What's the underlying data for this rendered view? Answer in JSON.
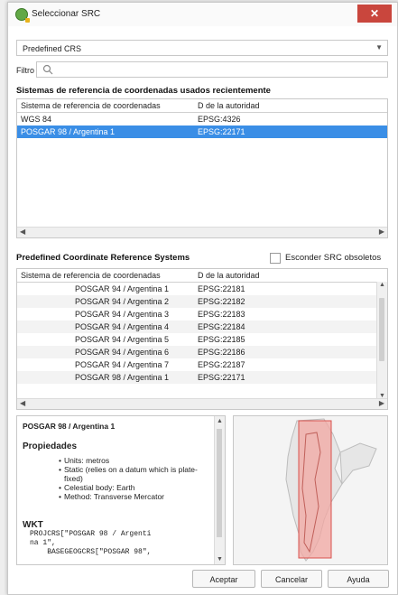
{
  "window": {
    "title": "Seleccionar SRC",
    "close_glyph": "✕"
  },
  "crs_type": {
    "selected": "Predefined CRS"
  },
  "filter": {
    "label": "Filtro",
    "value": ""
  },
  "recent": {
    "title": "Sistemas de referencia de coordenadas usados recientemente",
    "columns": [
      "Sistema de referencia de coordenadas",
      "D de la autoridad"
    ],
    "rows": [
      {
        "name": "WGS 84",
        "id": "EPSG:4326",
        "selected": false
      },
      {
        "name": "POSGAR 98 / Argentina 1",
        "id": "EPSG:22171",
        "selected": true
      }
    ]
  },
  "predefined": {
    "title": "Predefined Coordinate Reference Systems",
    "hide_deprecated_label": "Esconder SRC obsoletos",
    "hide_deprecated_checked": false,
    "columns": [
      "Sistema de referencia de coordenadas",
      "D de la autoridad"
    ],
    "rows": [
      {
        "name": "POSGAR 94 / Argentina 1",
        "id": "EPSG:22181"
      },
      {
        "name": "POSGAR 94 / Argentina 2",
        "id": "EPSG:22182"
      },
      {
        "name": "POSGAR 94 / Argentina 3",
        "id": "EPSG:22183"
      },
      {
        "name": "POSGAR 94 / Argentina 4",
        "id": "EPSG:22184"
      },
      {
        "name": "POSGAR 94 / Argentina 5",
        "id": "EPSG:22185"
      },
      {
        "name": "POSGAR 94 / Argentina 6",
        "id": "EPSG:22186"
      },
      {
        "name": "POSGAR 94 / Argentina 7",
        "id": "EPSG:22187"
      },
      {
        "name": "POSGAR 98 / Argentina 1",
        "id": "EPSG:22171"
      }
    ]
  },
  "info": {
    "crs_name": "POSGAR 98 / Argentina 1",
    "properties_title": "Propiedades",
    "properties": [
      "Units: metros",
      "Static (relies on a datum which is plate-fixed)",
      "Celestial body: Earth",
      "Method: Transverse Mercator"
    ],
    "wkt_title": "WKT",
    "wkt_lines": [
      "PROJCRS[\"POSGAR 98 / Argenti",
      "na 1\",",
      "    BASEGEOGCRS[\"POSGAR 98\","
    ]
  },
  "buttons": {
    "accept": "Aceptar",
    "cancel": "Cancelar",
    "help": "Ayuda"
  },
  "colors": {
    "selection": "#3a8ee6",
    "map_extent_fill": "#f2a7a2",
    "map_extent_stroke": "#d9534f",
    "qgis_green": "#62a846"
  }
}
